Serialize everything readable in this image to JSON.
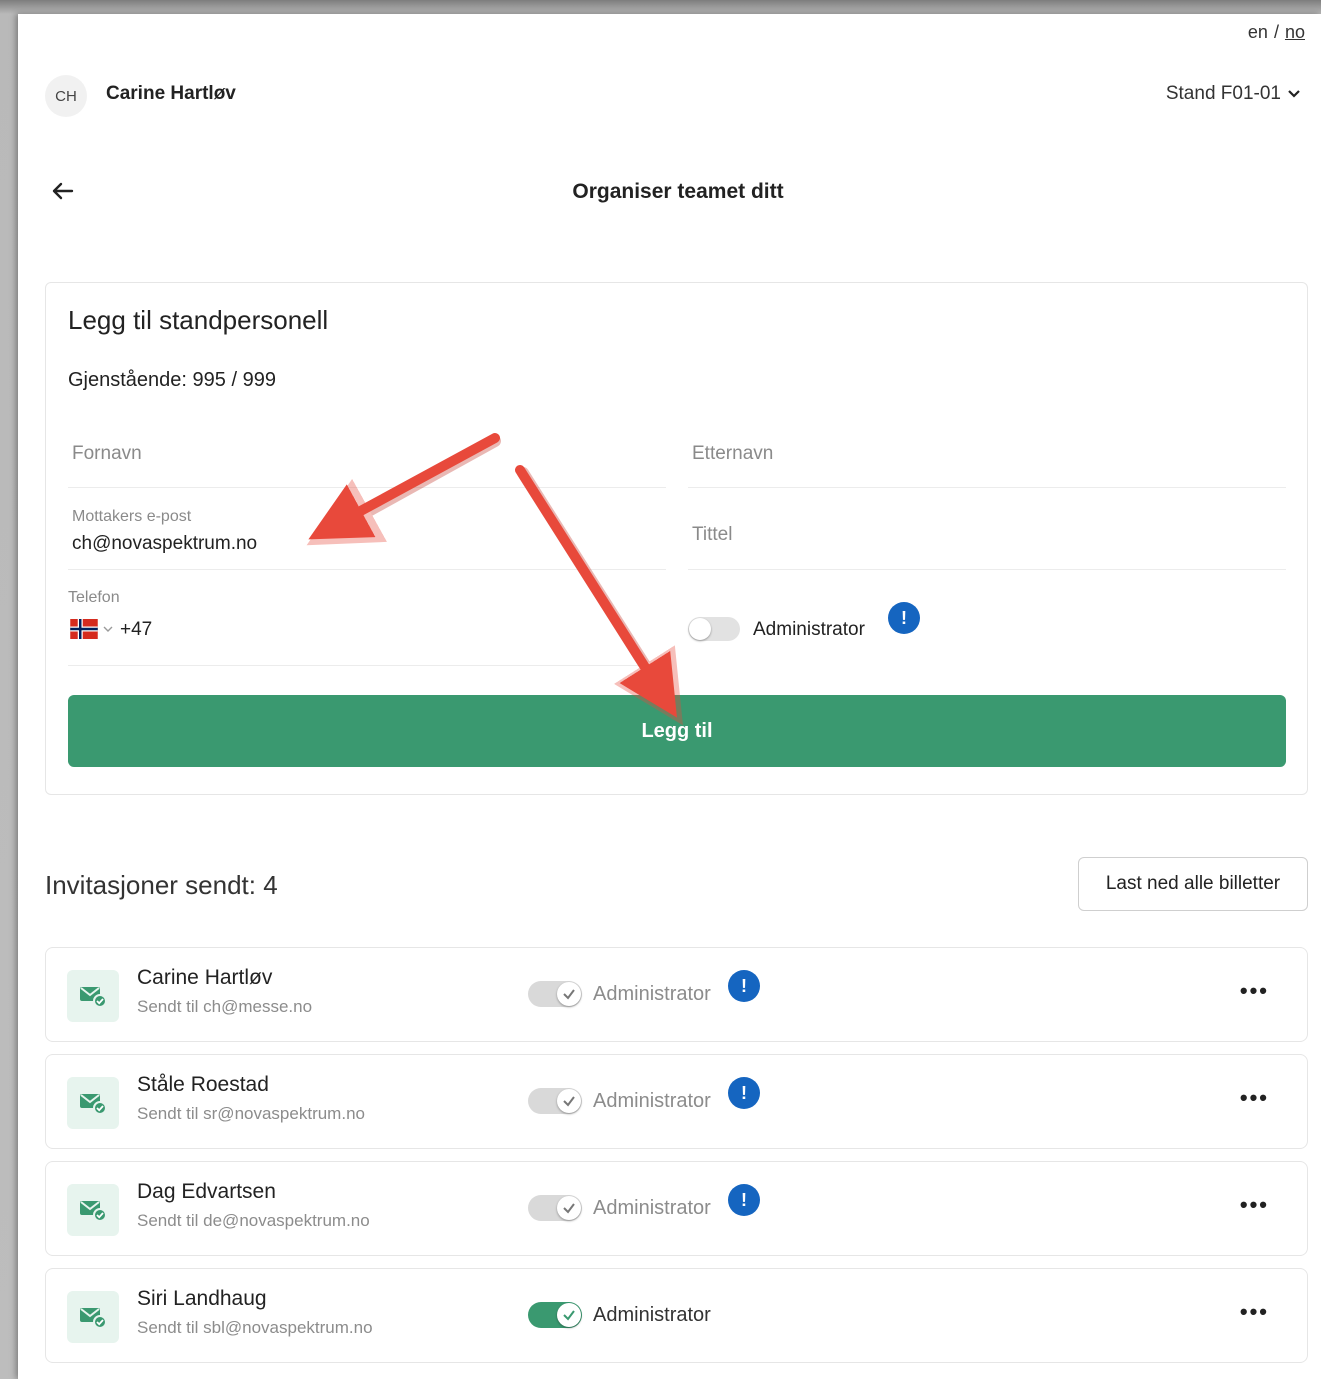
{
  "header": {
    "lang_en": "en",
    "lang_sep": "/",
    "lang_no": "no",
    "avatar_initials": "CH",
    "user_name": "Carine Hartløv",
    "stand_label": "Stand F01-01"
  },
  "page_title": "Organiser teamet ditt",
  "form": {
    "title": "Legg til standpersonell",
    "remaining": "Gjenstående: 995 / 999",
    "first_name_placeholder": "Fornavn",
    "last_name_placeholder": "Etternavn",
    "email_label": "Mottakers e-post",
    "email_value": "ch@novaspektrum.no",
    "title_placeholder": "Tittel",
    "phone_label": "Telefon",
    "phone_prefix": "+47",
    "admin_label": "Administrator",
    "admin_enabled": false,
    "submit_label": "Legg til"
  },
  "invitations": {
    "title": "Invitasjoner sendt: 4",
    "download_label": "Last ned alle billetter",
    "items": [
      {
        "name": "Carine Hartløv",
        "sent": "Sendt til ch@messe.no",
        "admin_label": "Administrator",
        "admin_on": false
      },
      {
        "name": "Ståle Roestad",
        "sent": "Sendt til sr@novaspektrum.no",
        "admin_label": "Administrator",
        "admin_on": false
      },
      {
        "name": "Dag Edvartsen",
        "sent": "Sendt til de@novaspektrum.no",
        "admin_label": "Administrator",
        "admin_on": false
      },
      {
        "name": "Siri Landhaug",
        "sent": "Sendt til sbl@novaspektrum.no",
        "admin_label": "Administrator",
        "admin_on": true
      }
    ]
  },
  "colors": {
    "primary_green": "#3a9970",
    "info_blue": "#1565c0",
    "annotation_red": "#e8493b"
  },
  "icons": {
    "back": "arrow-left-icon",
    "stand_chevron": "chevron-down-icon",
    "flag": "norway-flag-icon",
    "info": "info-icon",
    "invite": "mail-check-icon",
    "more": "more-dots-icon"
  }
}
